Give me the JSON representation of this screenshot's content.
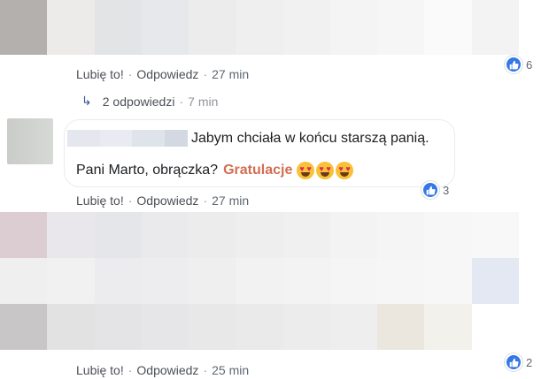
{
  "comments": [
    {
      "id": "top",
      "blurred": true,
      "actions": {
        "like": "Lubię to!",
        "reply": "Odpowiedz",
        "time": "27 min"
      },
      "reactions": {
        "count": "6",
        "icon": "thumbs-up-icon"
      },
      "replies": {
        "label": "2 odpowiedzi",
        "time": "7 min"
      }
    },
    {
      "id": "middle",
      "blurred": false,
      "text_line1": "Jabym chciała w końcu starszą panią.",
      "text_line2": "Pani Marto, obrączka?",
      "highlight": "Gratulacje",
      "emojis": [
        "heart-eyes-emoji",
        "heart-eyes-emoji",
        "heart-eyes-emoji"
      ],
      "actions": {
        "like": "Lubię to!",
        "reply": "Odpowiedz",
        "time": "27 min"
      },
      "reactions": {
        "count": "3",
        "icon": "thumbs-up-icon"
      }
    },
    {
      "id": "bottom",
      "blurred": true,
      "actions": {
        "like": "Lubię to!",
        "reply": "Odpowiedz",
        "time": "25 min"
      },
      "reactions": {
        "count": "2",
        "icon": "thumbs-up-icon"
      }
    }
  ],
  "separators": {
    "dot": "·"
  },
  "colors": {
    "like_blue": "#3578e5",
    "highlight": "#d16e52",
    "link_gray": "#606770"
  }
}
